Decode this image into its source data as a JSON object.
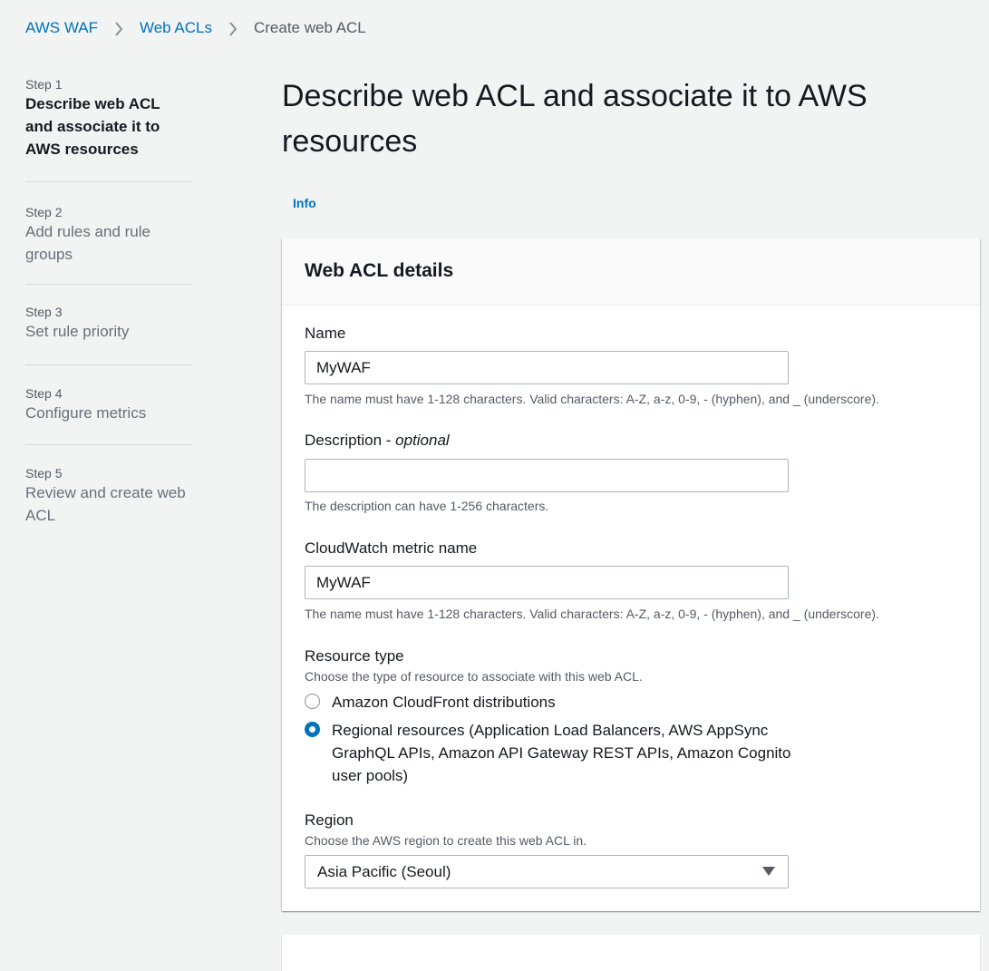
{
  "breadcrumb": {
    "items": [
      "AWS WAF",
      "Web ACLs"
    ],
    "current": "Create web ACL"
  },
  "steps": [
    {
      "num": "Step 1",
      "title": "Describe web ACL and associate it to AWS resources",
      "active": true
    },
    {
      "num": "Step 2",
      "title": "Add rules and rule groups",
      "active": false
    },
    {
      "num": "Step 3",
      "title": "Set rule priority",
      "active": false
    },
    {
      "num": "Step 4",
      "title": "Configure metrics",
      "active": false
    },
    {
      "num": "Step 5",
      "title": "Review and create web ACL",
      "active": false
    }
  ],
  "page": {
    "title": "Describe web ACL and associate it to AWS resources",
    "info_link": "Info"
  },
  "panel": {
    "title": "Web ACL details",
    "name": {
      "label": "Name",
      "value": "MyWAF",
      "constraint": "The name must have 1-128 characters. Valid characters: A-Z, a-z, 0-9, - (hyphen), and _ (underscore)."
    },
    "description": {
      "label": "Description - ",
      "label_optional": "optional",
      "value": "",
      "constraint": "The description can have 1-256 characters."
    },
    "metric": {
      "label": "CloudWatch metric name",
      "value": "MyWAF",
      "constraint": "The name must have 1-128 characters. Valid characters: A-Z, a-z, 0-9, - (hyphen), and _ (underscore)."
    },
    "resource_type": {
      "label": "Resource type",
      "description": "Choose the type of resource to associate with this web ACL.",
      "options": [
        {
          "label": "Amazon CloudFront distributions",
          "selected": false
        },
        {
          "label": "Regional resources (Application Load Balancers, AWS AppSync GraphQL APIs, Amazon API Gateway REST APIs, Amazon Cognito user pools)",
          "selected": true
        }
      ]
    },
    "region": {
      "label": "Region",
      "description": "Choose the AWS region to create this web ACL in.",
      "value": "Asia Pacific (Seoul)"
    }
  },
  "colors": {
    "link": "#0073bb",
    "background": "#f2f3f3",
    "panel_header": "#fafafa",
    "radio_selected": "#0073bb"
  },
  "icons": [
    "chevron-right-icon",
    "caret-down-icon"
  ]
}
